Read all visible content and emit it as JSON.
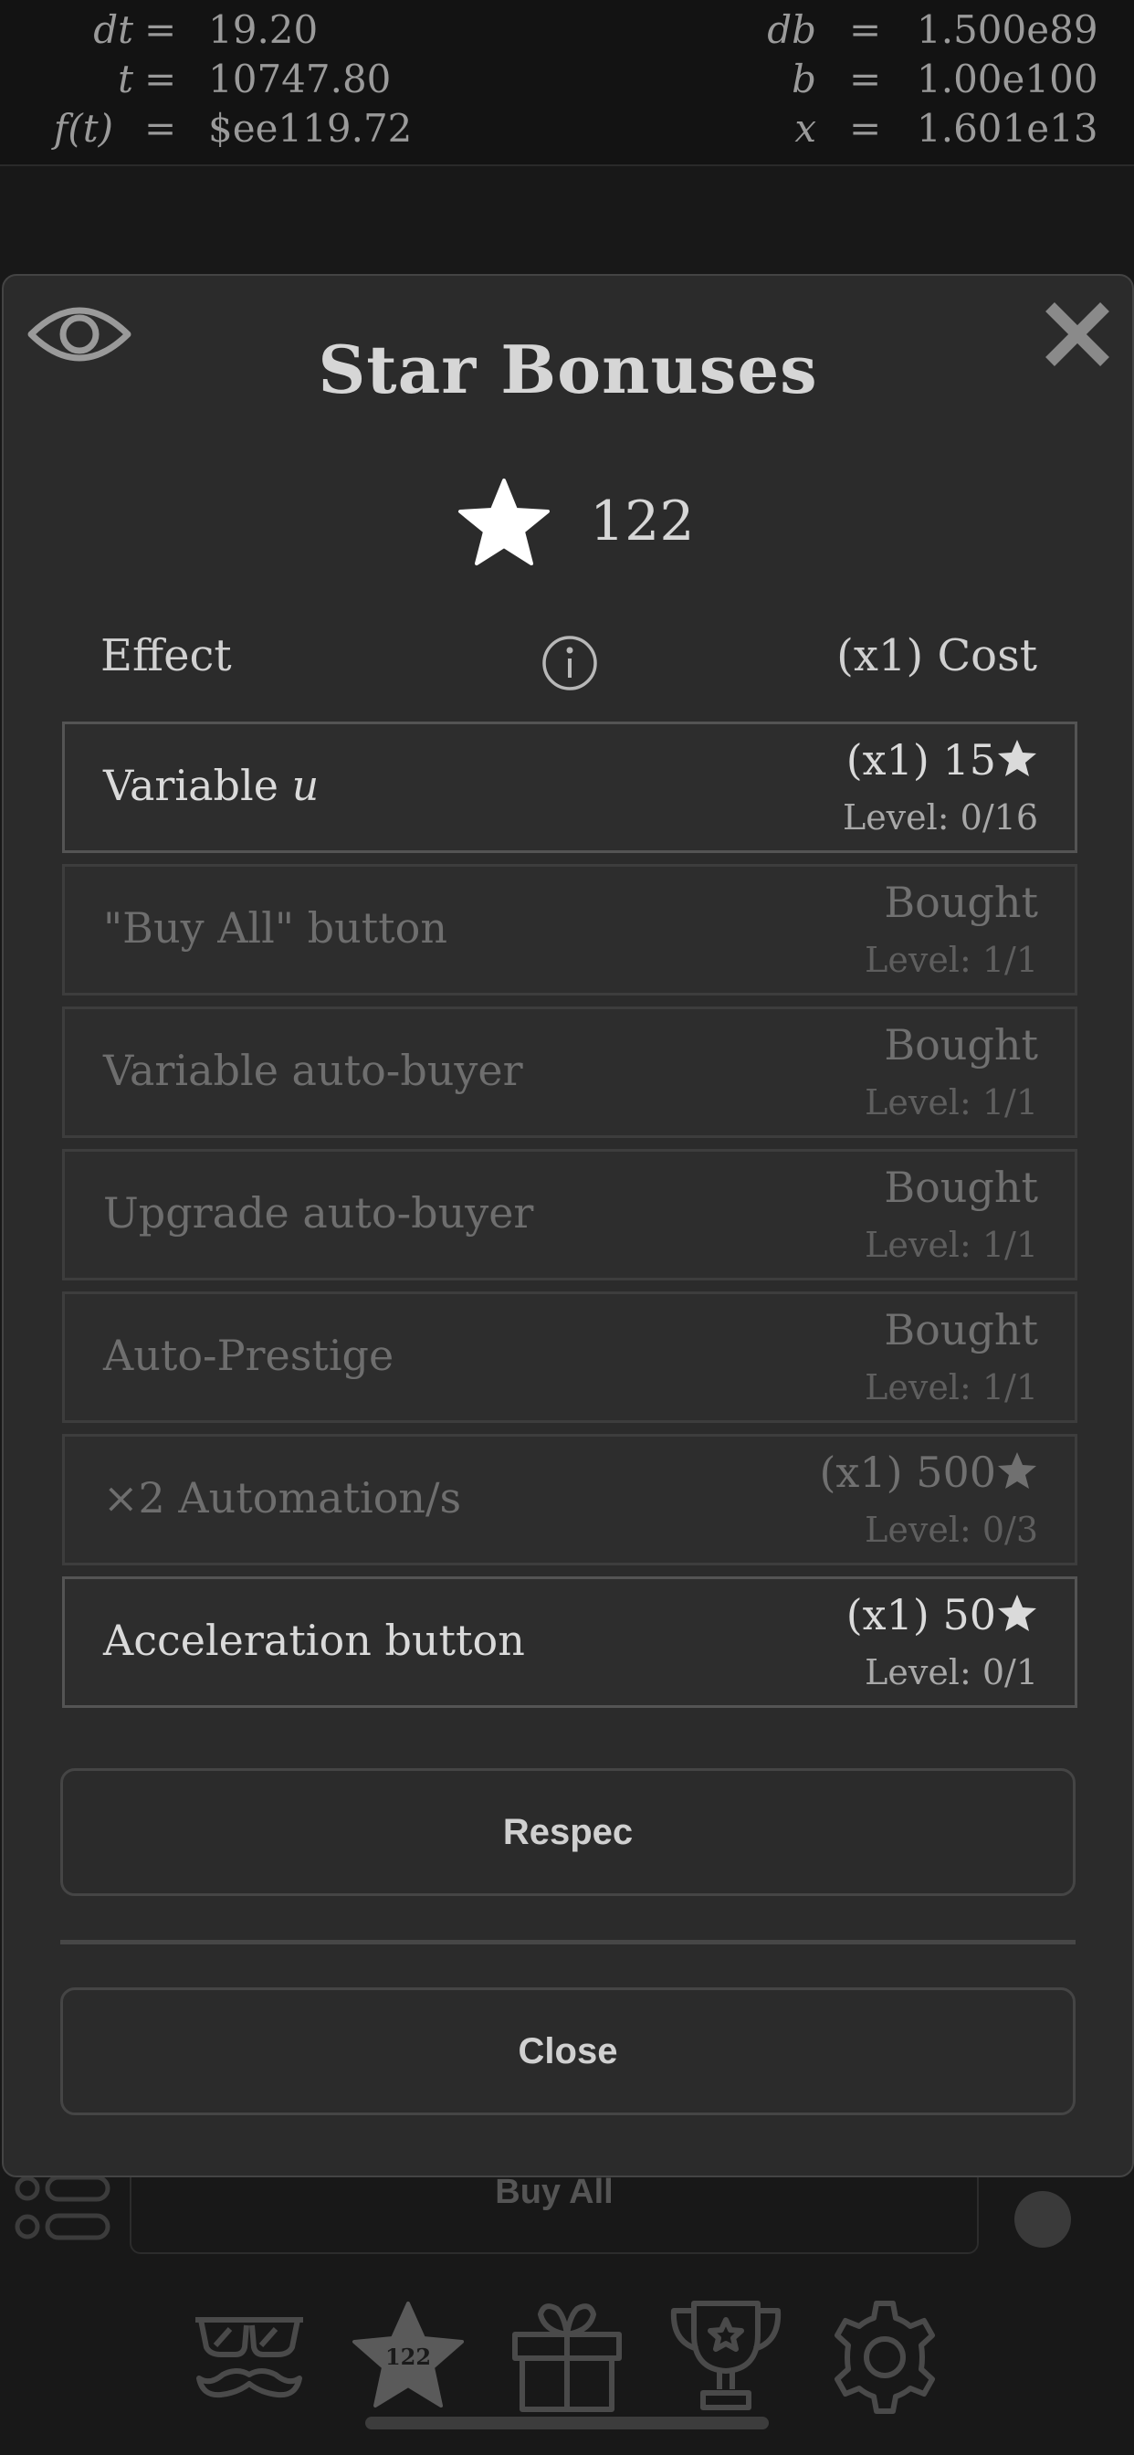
{
  "equations": {
    "left": [
      {
        "lhs": "dt",
        "eq": "=",
        "rhs": "19.20"
      },
      {
        "lhs": "t",
        "eq": "=",
        "rhs": "10747.80"
      },
      {
        "lhs": "f(t)",
        "eq": "=",
        "rhs": "$ee119.72"
      }
    ],
    "right": [
      {
        "lhs": "db",
        "eq": "=",
        "rhs": "1.500e89"
      },
      {
        "lhs": "b",
        "eq": "=",
        "rhs": "1.00e100"
      },
      {
        "lhs": "x",
        "eq": "=",
        "rhs": "1.601e13"
      }
    ]
  },
  "modal": {
    "title": "Star Bonuses",
    "star_count": "122",
    "header_effect": "Effect",
    "header_cost": "(x1) Cost",
    "rows": [
      {
        "effect": "Variable ",
        "effect_var": "u",
        "cost": "(x1) 15",
        "cost_star": true,
        "level": "Level: 0/16",
        "active": true
      },
      {
        "effect": "\"Buy All\" button",
        "cost": "Bought",
        "cost_star": false,
        "level": "Level: 1/1",
        "active": false
      },
      {
        "effect": "Variable auto-buyer",
        "cost": "Bought",
        "cost_star": false,
        "level": "Level: 1/1",
        "active": false
      },
      {
        "effect": "Upgrade auto-buyer",
        "cost": "Bought",
        "cost_star": false,
        "level": "Level: 1/1",
        "active": false
      },
      {
        "effect": "Auto-Prestige",
        "cost": "Bought",
        "cost_star": false,
        "level": "Level: 1/1",
        "active": false
      },
      {
        "effect": "×2 Automation/s",
        "cost": "(x1) 500",
        "cost_star": true,
        "level": "Level: 0/3",
        "active": false
      },
      {
        "effect": "Acceleration button",
        "cost": "(x1) 50",
        "cost_star": true,
        "level": "Level: 0/1",
        "active": true
      }
    ],
    "respec_label": "Respec",
    "close_label": "Close"
  },
  "background": {
    "buy_all_label": "Buy All",
    "nav_star_badge": "122"
  },
  "icons": [
    "eye-icon",
    "close-icon",
    "star-icon",
    "info-icon",
    "list-icon",
    "glasses-mustache-icon",
    "star-tab-icon",
    "gift-icon",
    "trophy-icon",
    "gear-icon"
  ],
  "colors": {
    "modal_bg": "#2b2b2b",
    "page_bg": "#181818",
    "text": "#d6d6d6",
    "muted": "#6e6e6e"
  }
}
